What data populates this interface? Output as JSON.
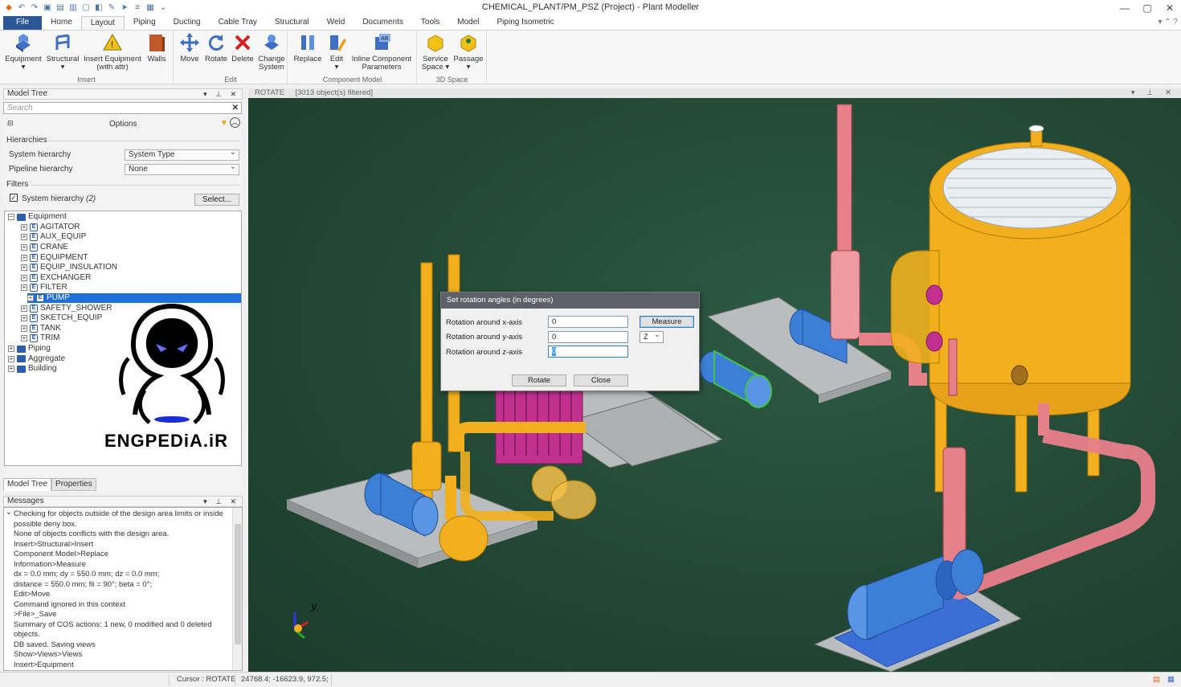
{
  "window": {
    "title": "CHEMICAL_PLANT/PM_PSZ (Project) - Plant Modeller",
    "minimize": "—",
    "maximize": "▢",
    "close": "✕"
  },
  "tabs": [
    "File",
    "Home",
    "Layout",
    "Piping",
    "Ducting",
    "Cable Tray",
    "Structural",
    "Weld",
    "Documents",
    "Tools",
    "Model",
    "Piping Isometric"
  ],
  "active_tab": "Layout",
  "ribbon": {
    "groups": [
      {
        "label": "Insert",
        "buttons": [
          {
            "label": "Equipment",
            "sub": "▾",
            "icon": "equipment-icon"
          },
          {
            "label": "Structural",
            "sub": "▾",
            "icon": "structural-icon"
          },
          {
            "label": "Insert Equipment",
            "sub": "(with attr)",
            "icon": "insert-equipment-icon"
          },
          {
            "label": "Walls",
            "sub": "",
            "icon": "walls-icon"
          }
        ]
      },
      {
        "label": "Edit",
        "buttons": [
          {
            "label": "Move",
            "sub": "",
            "icon": "move-icon"
          },
          {
            "label": "Rotate",
            "sub": "",
            "icon": "rotate-icon"
          },
          {
            "label": "Delete",
            "sub": "",
            "icon": "delete-icon"
          },
          {
            "label": "Change",
            "sub": "System",
            "icon": "change-system-icon"
          }
        ]
      },
      {
        "label": "Component Model",
        "buttons": [
          {
            "label": "Replace",
            "sub": "",
            "icon": "replace-icon"
          },
          {
            "label": "Edit",
            "sub": "▾",
            "icon": "edit-component-icon"
          },
          {
            "label": "Inline Component",
            "sub": "Parameters",
            "icon": "inline-component-icon"
          }
        ]
      },
      {
        "label": "3D Space",
        "buttons": [
          {
            "label": "Service",
            "sub": "Space ▾",
            "icon": "service-space-icon"
          },
          {
            "label": "Passage",
            "sub": "▾",
            "icon": "passage-icon"
          }
        ]
      }
    ]
  },
  "model_tree": {
    "title": "Model Tree",
    "search_placeholder": "Search",
    "options_label": "Options",
    "hierarchies_label": "Hierarchies",
    "system_hierarchy_label": "System hierarchy",
    "system_hierarchy_value": "System Type",
    "pipeline_hierarchy_label": "Pipeline hierarchy",
    "pipeline_hierarchy_value": "None",
    "filters_label": "Filters",
    "filter_checkbox_label": "System hierarchy",
    "filter_checkbox_count": "(2)",
    "select_button": "Select...",
    "root": "Equipment",
    "children": [
      "AGITATOR",
      "AUX_EQUIP",
      "CRANE",
      "EQUIPMENT",
      "EQUIP_INSULATION",
      "EXCHANGER",
      "FILTER",
      "PUMP",
      "SAFETY_SHOWER",
      "SKETCH_EQUIP",
      "TANK",
      "TRIM"
    ],
    "selected": "PUMP",
    "others": [
      "Piping",
      "Aggregate",
      "Building"
    ],
    "bottom_tabs": [
      "Model Tree",
      "Properties"
    ]
  },
  "messages": {
    "title": "Messages",
    "lines": [
      "Checking for objects outside of the design area limits or inside",
      "possible deny box.",
      "None of objects conflicts with the design area.",
      "Insert>Structural>Insert",
      "Component Model>Replace",
      "Information>Measure",
      " dx = 0.0 mm; dy = 550.0 mm; dz = 0.0 mm;",
      " distance = 550.0 mm; fii = 90°; beta = 0°;",
      " Edit>Move",
      "Command ignored in this context",
      " >File>_Save",
      " Summary of COS actions: 1 new, 0 modified and 0 deleted",
      "objects.",
      " DB saved. Saving views",
      "Show>Views>Views",
      "Insert>Equipment"
    ]
  },
  "viewport": {
    "mode": "ROTATE",
    "filter_info": "[3013 object(s) filtered]",
    "axis_y": "y"
  },
  "dialog": {
    "title": "Set rotation angles (in degrees)",
    "x_label": "Rotation around x-axis",
    "x_value": "0",
    "y_label": "Rotation around y-axis",
    "y_value": "0",
    "z_label": "Rotation around z-axis",
    "z_value": "0",
    "measure_button": "Measure",
    "axis_select": "Z",
    "rotate_button": "Rotate",
    "close_button": "Close"
  },
  "watermark": "ENGPEDiA.iR",
  "status": {
    "cursor": "Cursor : ROTATE",
    "coords": "24768.4; -16623.9, 972.5;"
  },
  "colors": {
    "accent": "#2b5797",
    "selection": "#1e6fd9",
    "viewport_bg": "#244b37",
    "tank_yellow": "#f2b01e",
    "pipe_pink": "#e8808a",
    "pump_blue": "#3d7fd6",
    "foundation_grey": "#b9bdbd"
  }
}
